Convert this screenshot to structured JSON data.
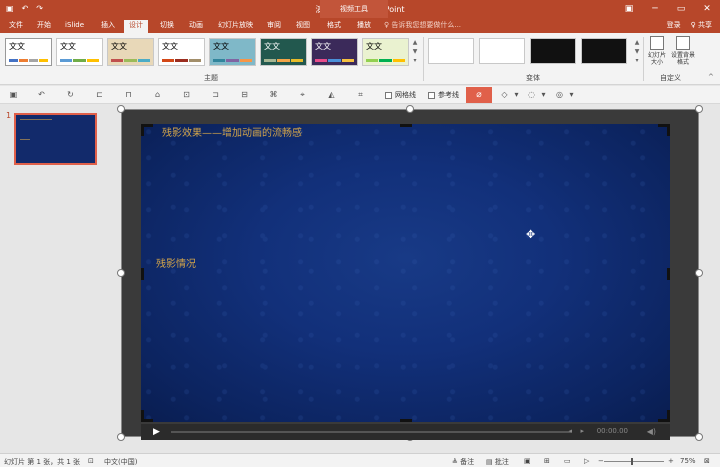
{
  "window": {
    "title": "演示文稿2 - PowerPoint",
    "context_tab": "视频工具",
    "minimize": "─",
    "restore": "▭",
    "close": "✕"
  },
  "menu": {
    "tabs": [
      "文件",
      "开始",
      "iSlide",
      "插入",
      "设计",
      "切换",
      "动画",
      "幻灯片放映",
      "审阅",
      "视图",
      "格式",
      "播放"
    ],
    "active_tab": "设计",
    "search_placeholder": "♀ 告诉我您想要做什么...",
    "login": "登录",
    "share": "♀ 共享"
  },
  "ribbon": {
    "theme_label": "文文",
    "themes_group_label": "主题",
    "variants_group_label": "变体",
    "customize_group_label": "自定义",
    "slide_size_label": "幻灯片大小",
    "format_background_label": "设置背景格式"
  },
  "video_toolbar": {
    "gridlines_label": "网格线",
    "guides_label": "参考线"
  },
  "thumbnails": {
    "slide_number": "1"
  },
  "slide": {
    "title": "残影效果——增加动画的流畅感",
    "body_text": "残影情况"
  },
  "playbar": {
    "play_icon": "▶",
    "time": "00:00.00",
    "volume_icon": "◀)"
  },
  "statusbar": {
    "slide_info": "幻灯片 第 1 张，共 1 张",
    "language": "中文(中国)",
    "notes": "≜ 备注",
    "comments": "▤ 批注",
    "zoom": "75%"
  }
}
